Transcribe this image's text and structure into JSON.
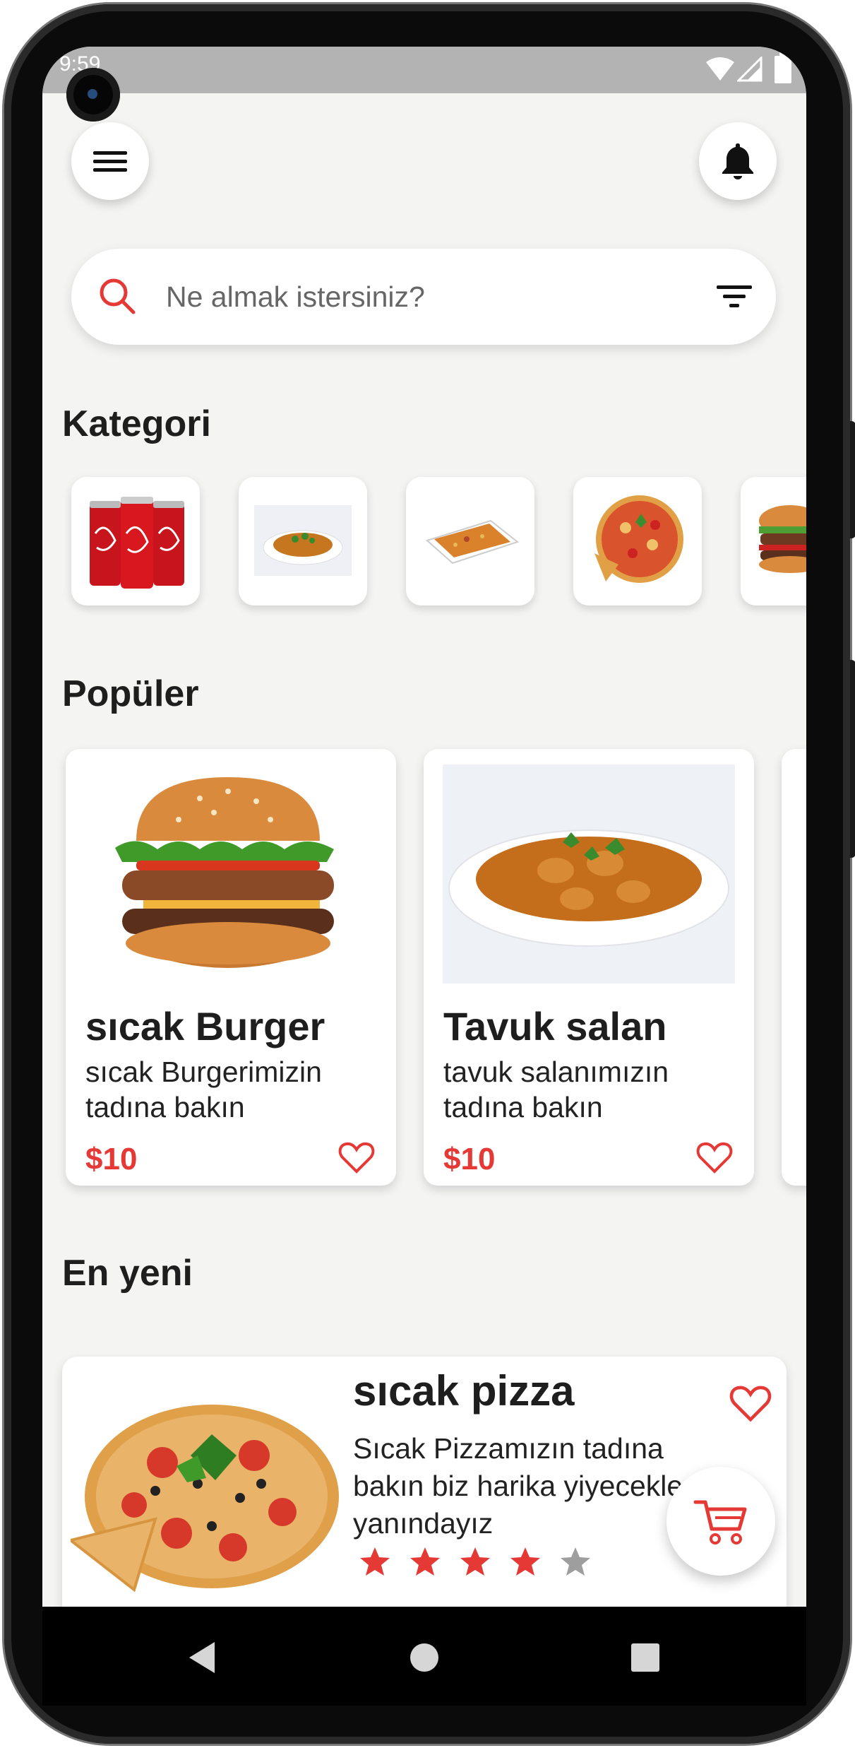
{
  "status_bar": {
    "time": "9:59"
  },
  "header": {
    "menu_icon": "hamburger-menu-icon",
    "notification_icon": "bell-icon"
  },
  "search": {
    "placeholder": "Ne almak istersiniz?",
    "search_icon": "search-icon",
    "filter_icon": "filter-icon"
  },
  "categories": {
    "title": "Kategori",
    "items": [
      {
        "image": "cola-cans-image"
      },
      {
        "image": "chicken-curry-image"
      },
      {
        "image": "rice-dish-image"
      },
      {
        "image": "pizza-image"
      },
      {
        "image": "burger-image"
      }
    ]
  },
  "popular": {
    "title": "Popüler",
    "items": [
      {
        "name": "sıcak Burger",
        "description": "sıcak Burgerimizin tadına bakın",
        "price": "$10",
        "image": "burger-image"
      },
      {
        "name": "Tavuk salan",
        "description": "tavuk salanımızın tadına bakın",
        "price": "$10",
        "image": "chicken-curry-image"
      }
    ]
  },
  "newest": {
    "title": "En yeni",
    "items": [
      {
        "name": "sıcak pizza",
        "description": "Sıcak Pizzamızın tadına bakın biz harika yiyeceklerin yanındayız",
        "rating": 4,
        "rating_max": 5,
        "image": "pizza-image"
      }
    ]
  },
  "fab": {
    "icon": "cart-icon"
  },
  "navigation": {
    "back": "back-icon",
    "home": "home-icon",
    "recents": "recents-icon"
  },
  "colors": {
    "accent": "#e53935",
    "background": "#f4f4f3",
    "star_inactive": "#9e9e9e"
  }
}
